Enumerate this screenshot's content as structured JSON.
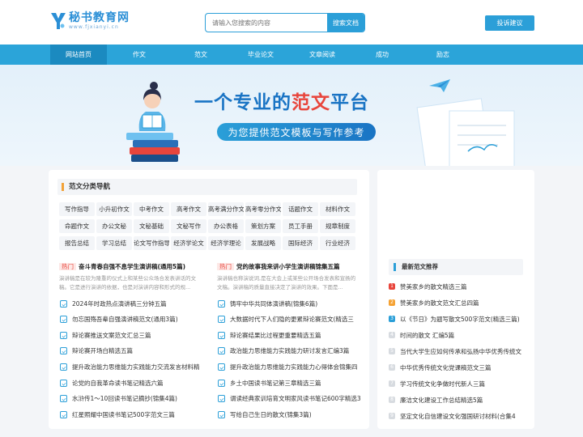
{
  "header": {
    "logo_title": "秘书教育网",
    "logo_sub": "www.fjxianyi.cn",
    "search_placeholder": "请输入您搜索的内容",
    "search_button": "搜索文档",
    "complaint_button": "投诉建议"
  },
  "nav": {
    "items": [
      "网站首页",
      "作文",
      "范文",
      "毕业论文",
      "文章阅读",
      "成功",
      "励志"
    ],
    "active_index": 0
  },
  "banner": {
    "title_part1": "一个专业的",
    "title_highlight": "范文",
    "title_part2": "平台",
    "subtitle": "为您提供范文模板与写作参考"
  },
  "categories": {
    "title": "范文分类导航",
    "items": [
      "写作指导",
      "小升初作文",
      "中考作文",
      "高考作文",
      "高考满分作文",
      "高考零分作文",
      "话题作文",
      "材料作文",
      "命题作文",
      "办公文秘",
      "文秘基础",
      "文秘写作",
      "办公表格",
      "策划方案",
      "员工手册",
      "规章制度",
      "报告总结",
      "学习总结",
      "论文写作指导",
      "经济学论文",
      "经济学理论",
      "发展战略",
      "国际经济",
      "行业经济"
    ]
  },
  "hot": [
    {
      "tag": "热门",
      "title": "奋斗青春自强不息学生演讲稿(通用5篇)",
      "desc": "演讲稿是在较为隆重的仪式上和某些公众场合发表讲话的文稿。它是进行演讲的依据，也是对演讲内容和形式的规...",
      "items": [
        "2024年时政热点演讲稿三分钟五篇",
        "勿忘国殇吾辈自强演讲稿范文(通用3篇)",
        "辩论赛推送文案范文汇总三篇",
        "辩论赛开场白精选五篇",
        "提升政治能力思维能力实践能力交流发言材料精",
        "论党的自我革命读书笔记精选六篇",
        "水浒传1～10回读书笔记摘抄(锦集4篇)",
        "红星照耀中国读书笔记500字范文三篇"
      ]
    },
    {
      "tag": "热门",
      "title": "党的故事我来讲小学生演讲稿锦集五篇",
      "desc": "演讲稿也称演说词,是在大会上或某些公开场合发表和宣扬的文稿。演讲稿的质量直接决定了演讲的效果。下面是...",
      "items": [
        "铸牢中华共同体演讲稿(锦集6篇)",
        "大数据时代下人们隐的更累辩论赛范文(精选三",
        "辩论赛结果比过程更重要精选五篇",
        "政治能力思维能力实践能力研讨发言汇编3篇",
        "提升政治能力思维能力实践能力心得体会锦集四",
        "乡土中国读书笔记第三章精选三篇",
        "谓读经典家训培育文明家风读书笔记600字精选3",
        "写给自己生日的散文(锦集3篇)"
      ]
    }
  ],
  "recommend": {
    "title": "最新范文推荐",
    "items": [
      "赞美家乡的散文精选三篇",
      "赞美家乡的散文范文汇总四篇",
      "以《节日》为题写散文500字范文(精选三篇)",
      "时间的散文 汇编5篇",
      "当代大学生应如何传承和弘扬中华优秀传统文",
      "中华优秀传统文化党课稿范文三篇",
      "学习传统文化争做时代新人三篇",
      "廉洁文化建设工作总结精选5篇",
      "坚定文化自信建设文化强国研讨材料(合集4"
    ]
  }
}
